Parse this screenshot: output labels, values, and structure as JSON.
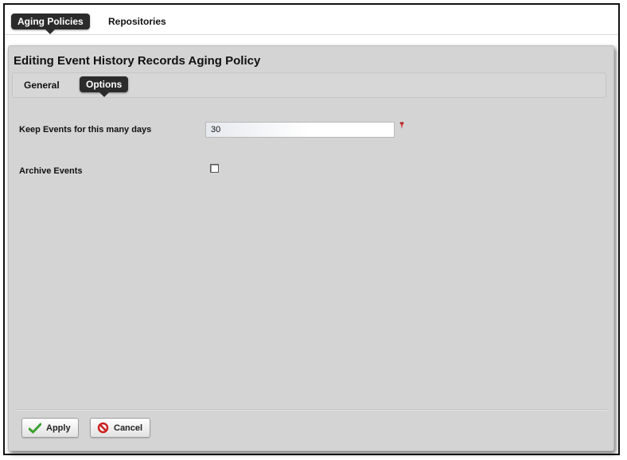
{
  "top_tabs": {
    "active": "Aging Policies",
    "other": "Repositories"
  },
  "dialog": {
    "title": "Editing Event History Records Aging Policy",
    "tabs": {
      "general": "General",
      "options": "Options"
    },
    "fields": {
      "keep_events_label": "Keep Events for this many days",
      "keep_events_value": "30",
      "archive_label": "Archive Events",
      "archive_checked": false
    },
    "buttons": {
      "apply": "Apply",
      "cancel": "Cancel"
    }
  },
  "icons": {
    "apply": "checkmark-icon",
    "cancel": "prohibited-icon",
    "required": "required-pin-icon"
  },
  "colors": {
    "tab_active_bg": "#2b2b2b",
    "dialog_bg": "#d4d4d4",
    "apply_check": "#3aa12e",
    "cancel_red": "#cc2020",
    "required_red": "#cc3333"
  }
}
